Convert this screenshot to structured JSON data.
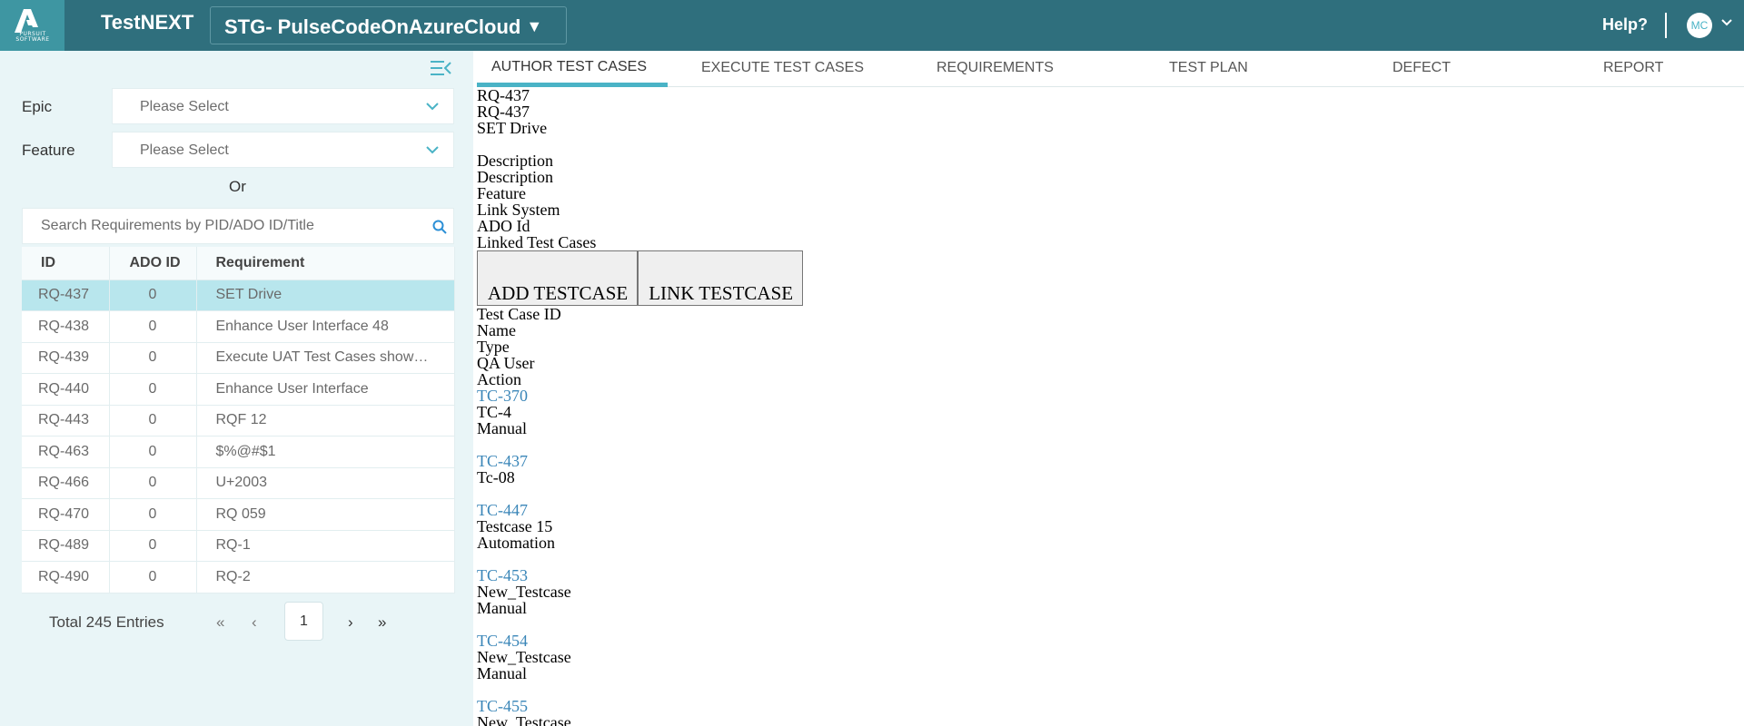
{
  "header": {
    "logo_text": "PURSUIT SOFTWARE",
    "app_title": "TestNEXT",
    "project": "STG- PulseCodeOnAzureCloud",
    "project_arrow": "▼",
    "help": "Help?",
    "avatar": "MC",
    "colors": {
      "topbar": "#2f6f7d",
      "logo_bg": "#3e96a2",
      "accent": "#4ab3c6"
    }
  },
  "sidebar": {
    "epic_label": "Epic",
    "epic_value": "Please Select",
    "feature_label": "Feature",
    "feature_value": "Please Select",
    "or": "Or",
    "search_placeholder": "Search Requirements by PID/ADO ID/Title",
    "table": {
      "headers": [
        "ID",
        "ADO ID",
        "Requirement"
      ],
      "rows": [
        [
          "RQ-437",
          "0",
          "SET Drive"
        ],
        [
          "RQ-438",
          "0",
          "Enhance User Interface 48"
        ],
        [
          "RQ-439",
          "0",
          "Execute UAT Test Cases show…"
        ],
        [
          "RQ-440",
          "0",
          "Enhance User Interface"
        ],
        [
          "RQ-443",
          "0",
          "RQF 12"
        ],
        [
          "RQ-463",
          "0",
          "$%@#$1"
        ],
        [
          "RQ-466",
          "0",
          "U+2003"
        ],
        [
          "RQ-470",
          "0",
          "RQ 059"
        ],
        [
          "RQ-489",
          "0",
          "RQ-1"
        ],
        [
          "RQ-490",
          "0",
          "RQ-2"
        ]
      ],
      "selected_row": 0
    },
    "pagination": {
      "total": "Total 245 Entries",
      "first": "«",
      "prev": "‹",
      "page": "1",
      "next": "›",
      "last": "»"
    }
  },
  "tabs": [
    {
      "label": "AUTHOR TEST CASES",
      "active": true
    },
    {
      "label": "EXECUTE TEST CASES"
    },
    {
      "label": "REQUIREMENTS"
    },
    {
      "label": "TEST PLAN"
    },
    {
      "label": "DEFECT"
    },
    {
      "label": "REPORT"
    }
  ],
  "detail": {
    "lines_top": [
      "RQ-437",
      "RQ-437",
      "SET Drive"
    ],
    "lines_meta": [
      "Description",
      "Description",
      "Feature",
      "Link System",
      "ADO Id",
      "Linked Test Cases"
    ],
    "add_button": "ADD TESTCASE",
    "link_button": "LINK TESTCASE",
    "columns": [
      "Test Case ID",
      "Name",
      "Type",
      "QA User",
      "Action"
    ],
    "testcases": [
      {
        "id": "TC-370",
        "name": "TC-4",
        "type": "Manual"
      },
      {
        "id": "TC-437",
        "name": "Tc-08",
        "type": ""
      },
      {
        "id": "TC-447",
        "name": "Testcase 15",
        "type": "Automation"
      },
      {
        "id": "TC-453",
        "name": "New_Testcase",
        "type": "Manual"
      },
      {
        "id": "TC-454",
        "name": "New_Testcase",
        "type": "Manual"
      },
      {
        "id": "TC-455",
        "name": "New_Testcase",
        "type": ""
      }
    ]
  }
}
